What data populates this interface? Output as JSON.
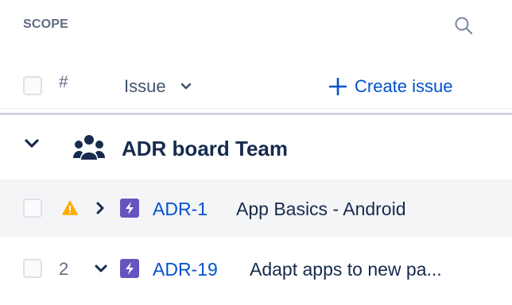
{
  "scope": {
    "title": "SCOPE",
    "search_icon": "search-icon"
  },
  "columns": {
    "number_label": "#",
    "issue_label": "Issue",
    "issue_sort_icon": "chevron-down-icon",
    "create_label": "Create issue",
    "create_icon": "plus-icon"
  },
  "team": {
    "name": "ADR board Team",
    "icon": "people-icon",
    "expand_icon": "chevron-down-icon"
  },
  "issues": [
    {
      "indicator": "warning-icon",
      "expand_icon": "chevron-right-icon",
      "type_icon": "epic-lightning-icon",
      "key": "ADR-1",
      "summary": "App Basics - Android"
    },
    {
      "number": "2",
      "expand_icon": "chevron-down-icon",
      "type_icon": "epic-lightning-icon",
      "key": "ADR-19",
      "summary": "Adapt apps to new pa..."
    }
  ],
  "colors": {
    "link_blue": "#0052cc",
    "epic_purple": "#6554c0",
    "warning_orange": "#ffab00",
    "text_dark": "#172b4d",
    "text_subtle": "#5e6c84",
    "row_highlight": "#f4f5f7"
  }
}
